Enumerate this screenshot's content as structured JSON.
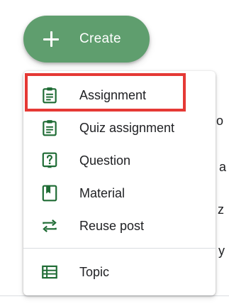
{
  "create_button": {
    "label": "Create",
    "icon": "plus-icon",
    "color": "#5f9e6e"
  },
  "menu": {
    "items": [
      {
        "label": "Assignment",
        "icon": "assignment-icon"
      },
      {
        "label": "Quiz assignment",
        "icon": "quiz-assignment-icon"
      },
      {
        "label": "Question",
        "icon": "question-icon"
      },
      {
        "label": "Material",
        "icon": "material-icon"
      },
      {
        "label": "Reuse post",
        "icon": "reuse-post-icon"
      }
    ],
    "topic": {
      "label": "Topic",
      "icon": "topic-icon"
    }
  },
  "highlight": {
    "color": "#e53935"
  },
  "icon_color": "#1e6b34",
  "background_fragments": [
    "o",
    "a",
    "z",
    "y"
  ]
}
